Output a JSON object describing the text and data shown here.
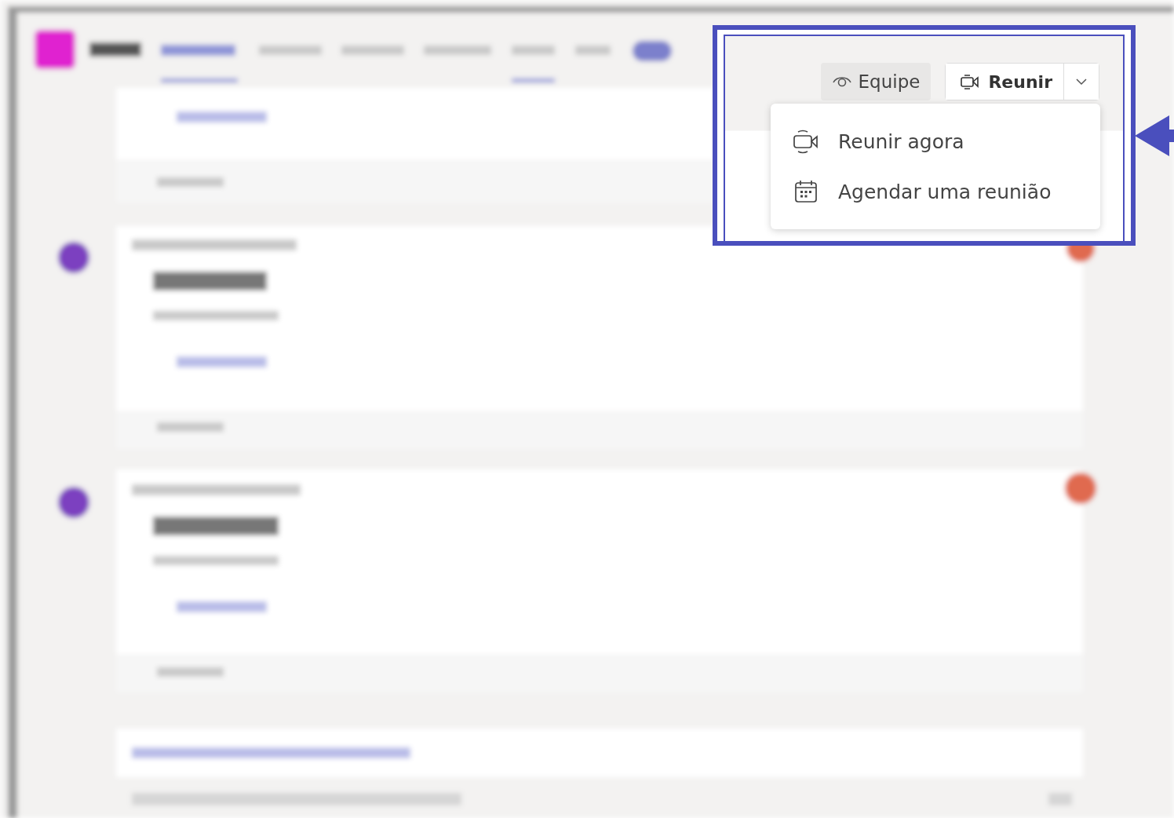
{
  "toolbar": {
    "team_button": {
      "label": "Equipe"
    },
    "meet_button": {
      "label": "Reunir"
    }
  },
  "meet_menu": {
    "items": [
      {
        "label": "Reunir agora",
        "kind": "video"
      },
      {
        "label": "Agendar uma reunião",
        "kind": "calendar"
      }
    ]
  }
}
